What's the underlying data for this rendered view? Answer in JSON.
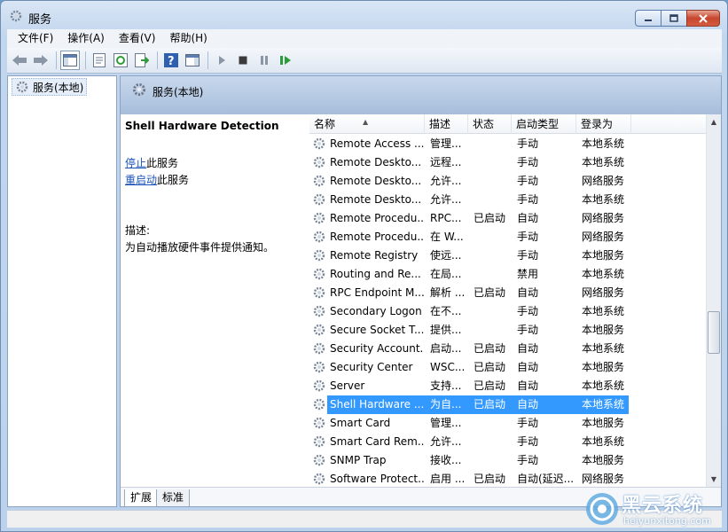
{
  "window": {
    "title": "服务"
  },
  "menubar": [
    "文件(F)",
    "操作(A)",
    "查看(V)",
    "帮助(H)"
  ],
  "tree": {
    "root_label": "服务(本地)"
  },
  "panel_header": {
    "title": "服务(本地)"
  },
  "extended": {
    "service_name": "Shell Hardware Detection",
    "stop_link": "停止",
    "stop_suffix": "此服务",
    "restart_link": "重启动",
    "restart_suffix": "此服务",
    "desc_label": "描述:",
    "desc_text": "为自动播放硬件事件提供通知。"
  },
  "columns": {
    "name": "名称",
    "desc": "描述",
    "status": "状态",
    "startup": "启动类型",
    "logon": "登录为"
  },
  "rows": [
    {
      "name": "Remote Access ...",
      "desc": "管理...",
      "status": "",
      "startup": "手动",
      "logon": "本地系统"
    },
    {
      "name": "Remote Deskto...",
      "desc": "远程...",
      "status": "",
      "startup": "手动",
      "logon": "本地系统"
    },
    {
      "name": "Remote Deskto...",
      "desc": "允许...",
      "status": "",
      "startup": "手动",
      "logon": "网络服务"
    },
    {
      "name": "Remote Deskto...",
      "desc": "允许...",
      "status": "",
      "startup": "手动",
      "logon": "本地系统"
    },
    {
      "name": "Remote Procedu...",
      "desc": "RPC...",
      "status": "已启动",
      "startup": "自动",
      "logon": "网络服务"
    },
    {
      "name": "Remote Procedu...",
      "desc": "在 W...",
      "status": "",
      "startup": "手动",
      "logon": "网络服务"
    },
    {
      "name": "Remote Registry",
      "desc": "使远...",
      "status": "",
      "startup": "手动",
      "logon": "本地服务"
    },
    {
      "name": "Routing and Re...",
      "desc": "在局...",
      "status": "",
      "startup": "禁用",
      "logon": "本地系统"
    },
    {
      "name": "RPC Endpoint M...",
      "desc": "解析 ...",
      "status": "已启动",
      "startup": "自动",
      "logon": "网络服务"
    },
    {
      "name": "Secondary Logon",
      "desc": "在不...",
      "status": "",
      "startup": "手动",
      "logon": "本地系统"
    },
    {
      "name": "Secure Socket T...",
      "desc": "提供...",
      "status": "",
      "startup": "手动",
      "logon": "本地服务"
    },
    {
      "name": "Security Account...",
      "desc": "启动...",
      "status": "已启动",
      "startup": "自动",
      "logon": "本地系统"
    },
    {
      "name": "Security Center",
      "desc": "WSC...",
      "status": "已启动",
      "startup": "自动",
      "logon": "本地服务"
    },
    {
      "name": "Server",
      "desc": "支持...",
      "status": "已启动",
      "startup": "自动",
      "logon": "本地系统"
    },
    {
      "name": "Shell Hardware ...",
      "desc": "为自...",
      "status": "已启动",
      "startup": "自动",
      "logon": "本地系统"
    },
    {
      "name": "Smart Card",
      "desc": "管理...",
      "status": "",
      "startup": "手动",
      "logon": "本地服务"
    },
    {
      "name": "Smart Card Rem...",
      "desc": "允许...",
      "status": "",
      "startup": "手动",
      "logon": "本地系统"
    },
    {
      "name": "SNMP Trap",
      "desc": "接收...",
      "status": "",
      "startup": "手动",
      "logon": "本地服务"
    },
    {
      "name": "Software Protect...",
      "desc": "启用 ...",
      "status": "已启动",
      "startup": "自动(延迟...",
      "logon": "网络服务"
    }
  ],
  "selected_row": 14,
  "tabs": {
    "extended": "扩展",
    "standard": "标准"
  },
  "watermark": {
    "cn": "黑云系统",
    "en": "heiyunxitong.com"
  },
  "colors": {
    "selection": "#3399ff",
    "link": "#1a53b8"
  }
}
